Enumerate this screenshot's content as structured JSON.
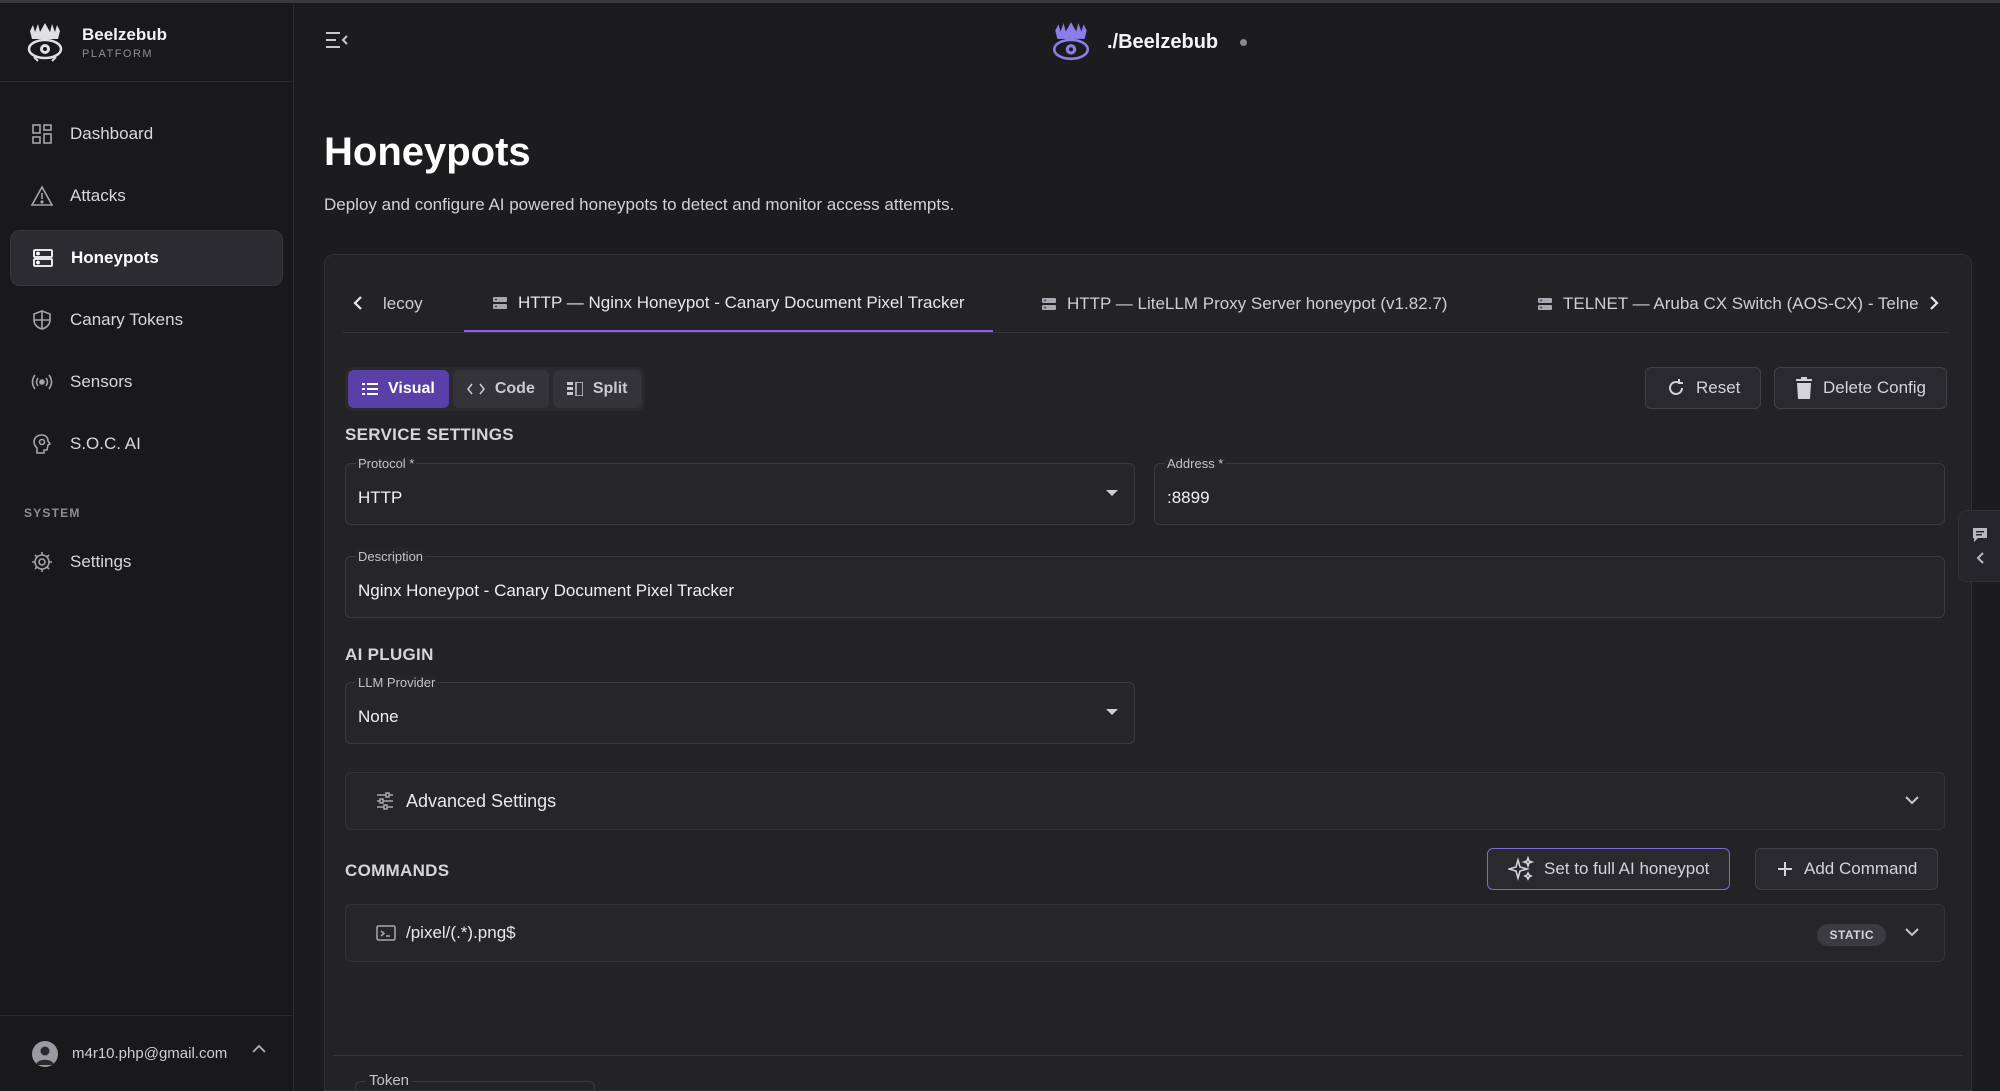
{
  "brand": {
    "name": "Beelzebub",
    "sub": "PLATFORM"
  },
  "nav": {
    "items": [
      {
        "label": "Dashboard",
        "icon": "grid-icon"
      },
      {
        "label": "Attacks",
        "icon": "warning-icon"
      },
      {
        "label": "Honeypots",
        "icon": "server-icon",
        "active": true
      },
      {
        "label": "Canary Tokens",
        "icon": "shield-icon"
      },
      {
        "label": "Sensors",
        "icon": "broadcast-icon"
      },
      {
        "label": "S.O.C. AI",
        "icon": "brain-icon"
      }
    ],
    "system_section": "SYSTEM",
    "settings_label": "Settings"
  },
  "user": {
    "email": "m4r10.php@gmail.com"
  },
  "header": {
    "title": "./Beelzebub"
  },
  "page": {
    "title": "Honeypots",
    "subtitle": "Deploy and configure AI powered honeypots to detect and monitor access attempts."
  },
  "tabs": [
    {
      "label": "lecoy"
    },
    {
      "label": "HTTP — Nginx Honeypot - Canary Document Pixel Tracker",
      "active": true
    },
    {
      "label": "HTTP — LiteLLM Proxy Server honeypot (v1.82.7)"
    },
    {
      "label": "TELNET — Aruba CX Switch (AOS-CX) - Telne"
    }
  ],
  "modes": {
    "visual": "Visual",
    "code": "Code",
    "split": "Split"
  },
  "actions": {
    "reset": "Reset",
    "delete": "Delete Config"
  },
  "service": {
    "title": "SERVICE SETTINGS",
    "protocol_label": "Protocol *",
    "protocol_value": "HTTP",
    "address_label": "Address *",
    "address_value": ":8899",
    "description_label": "Description",
    "description_value": "Nginx Honeypot - Canary Document Pixel Tracker"
  },
  "ai": {
    "title": "AI PLUGIN",
    "provider_label": "LLM Provider",
    "provider_value": "None"
  },
  "advanced": {
    "label": "Advanced Settings"
  },
  "commands": {
    "title": "COMMANDS",
    "ai_button": "Set to full AI honeypot",
    "add_button": "Add Command",
    "items": [
      {
        "pattern": "/pixel/(.*).png$",
        "badge": "STATIC"
      }
    ]
  },
  "token": {
    "label": "Token"
  },
  "colors": {
    "accent": "#8b5cf6",
    "active_mode": "#5b3fa8",
    "background": "#1c1c1e"
  }
}
